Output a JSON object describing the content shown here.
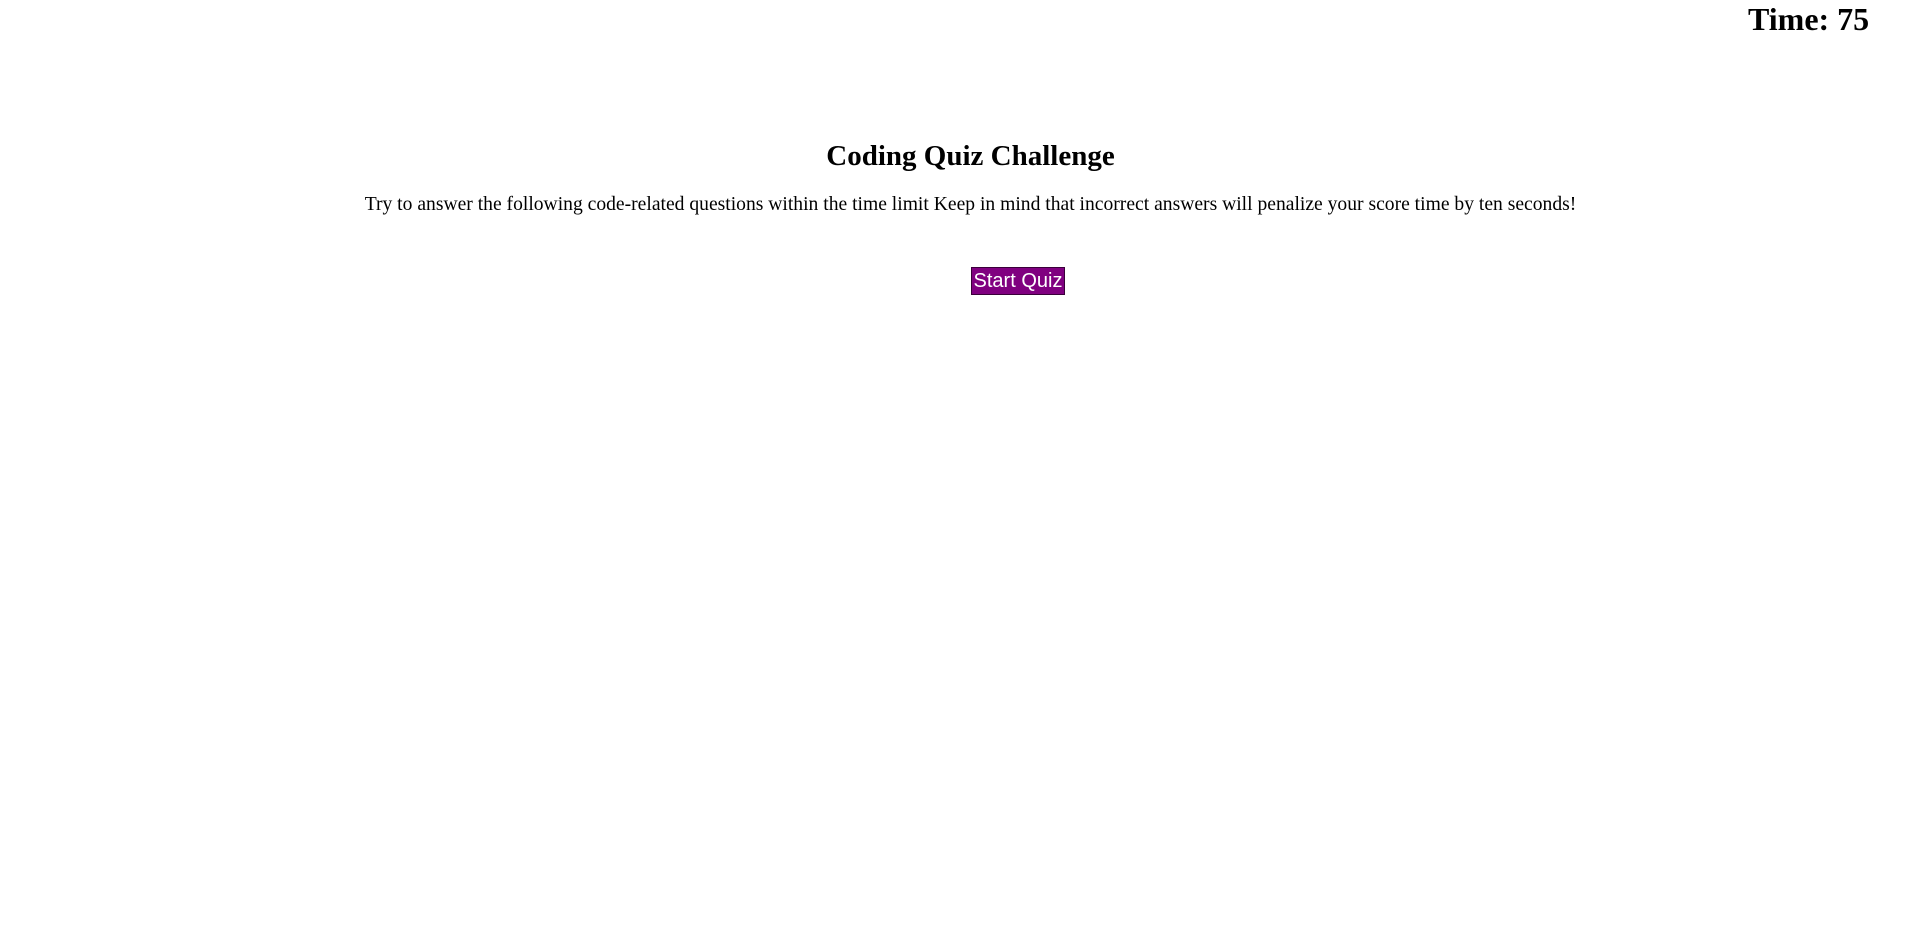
{
  "header": {
    "timer_label": "Time:",
    "timer_value": "75"
  },
  "intro": {
    "title": "Coding Quiz Challenge",
    "description": "Try to answer the following code-related questions within the time limit Keep in mind that incorrect answers will penalize your score time by ten seconds!"
  },
  "actions": {
    "start_label": "Start Quiz"
  },
  "colors": {
    "button_background": "#800080",
    "button_text": "#ffffff",
    "text": "#000000",
    "background": "#ffffff"
  }
}
